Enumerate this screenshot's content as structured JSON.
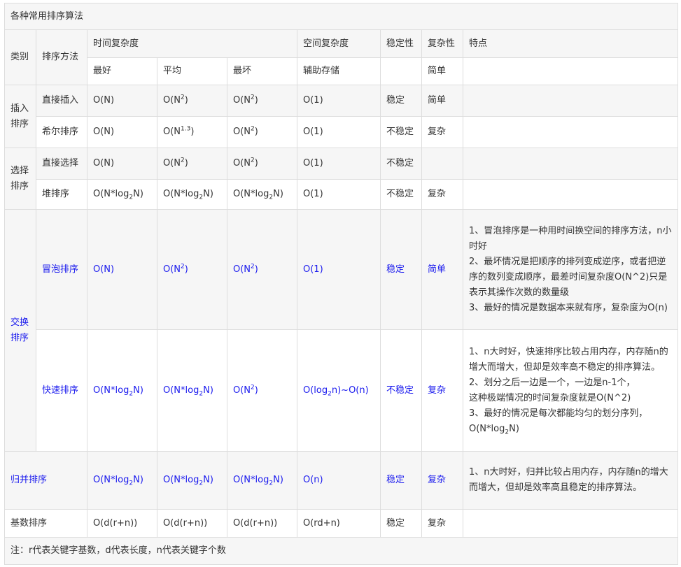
{
  "caption": "各种常用排序算法",
  "header": {
    "category": "类别",
    "method": "排序方法",
    "time_complexity": "时间复杂度",
    "space_complexity": "空间复杂度",
    "stability": "稳定性",
    "complexity": "复杂性",
    "features": "特点",
    "best": "最好",
    "average": "平均",
    "worst": "最坏",
    "aux_storage": "辅助存储",
    "simple": "简单"
  },
  "groups": {
    "insertion": "插入排序",
    "selection": "选择排序",
    "exchange": "交换排序"
  },
  "rows": {
    "direct_insertion": {
      "name": "直接插入",
      "best": "O(N)",
      "space": "O(1)",
      "stability": "稳定",
      "complexity": "简单"
    },
    "shell": {
      "name": "希尔排序",
      "best": "O(N)",
      "space": "O(1)",
      "stability": "不稳定",
      "complexity": "复杂"
    },
    "direct_selection": {
      "name": "直接选择",
      "best": "O(N)",
      "space": "O(1)",
      "stability": "不稳定"
    },
    "heap": {
      "name": "堆排序",
      "space": "O(1)",
      "stability": "不稳定",
      "complexity": "复杂"
    },
    "bubble": {
      "name": "冒泡排序",
      "best": "O(N)",
      "space": "O(1)",
      "stability": "稳定",
      "complexity": "简单",
      "features": [
        "1、冒泡排序是一种用时间换空间的排序方法，n小时好",
        "2、最坏情况是把顺序的排列变成逆序，或者把逆序的数列变成顺序，最差时间复杂度O(N^2)只是表示其操作次数的数量级",
        "3、最好的情况是数据本来就有序，复杂度为O(n)"
      ]
    },
    "quick": {
      "name": "快速排序",
      "stability": "不稳定",
      "complexity": "复杂",
      "features": [
        "1、n大时好，快速排序比较占用内存，内存随n的增大而增大，但却是效率高不稳定的排序算法。",
        "2、划分之后一边是一个，一边是n-1个，",
        "这种极端情况的时间复杂度就是O(N^2)",
        "3、最好的情况是每次都能均匀的划分序列，"
      ]
    },
    "merge": {
      "name": "归并排序",
      "space": "O(n)",
      "stability": "稳定",
      "complexity": "复杂",
      "features": [
        "1、n大时好，归并比较占用内存，内存随n的增大而增大，但却是效率高且稳定的排序算法。"
      ]
    },
    "radix": {
      "name": "基数排序",
      "best": "O(d(r+n))",
      "average": "O(d(r+n))",
      "worst": "O(d(r+n))",
      "space": "O(rd+n)",
      "stability": "稳定",
      "complexity": "复杂"
    }
  },
  "formula": {
    "O_N_open": "O(N",
    "close": ")",
    "exp2": "2",
    "exp13": "1.3",
    "nlog_pre": "O(N*log",
    "sub2": "2",
    "nlog_post": "N)",
    "log_pre": "O(log",
    "log_post": "n)~O(n)"
  },
  "note": "注：r代表关键字基数，d代表长度，n代表关键字个数"
}
